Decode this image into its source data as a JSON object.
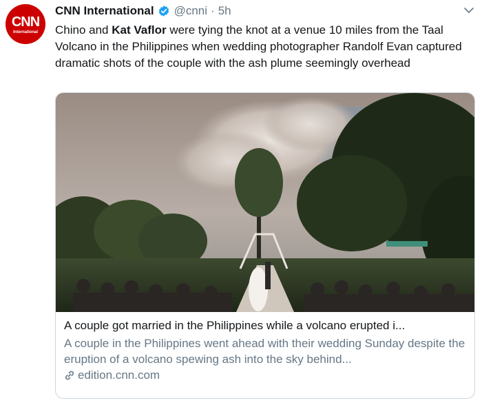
{
  "account": {
    "avatar_logo": "CNN",
    "avatar_sub": "International",
    "name": "CNN International",
    "handle": "@cnni",
    "separator": "·",
    "time": "5h",
    "verified_icon": "verified-badge-icon"
  },
  "tweet": {
    "text_part1": "Chino and ",
    "text_bold": "Kat Vaflor",
    "text_part2": " were tying the knot at a venue 10 miles from the Taal Volcano in the Philippines when wedding photographer Randolf Evan captured dramatic shots of the couple with the ash plume seemingly overhead"
  },
  "card": {
    "title": "A couple got married in the Philippines while a volcano erupted i...",
    "description": "A couple in the Philippines went ahead with their wedding Sunday despite the eruption of a volcano spewing ash into the sky behind...",
    "domain": "edition.cnn.com",
    "link_icon": "link-icon"
  },
  "colors": {
    "avatar_red": "#cc0000",
    "verified_blue": "#1da1f2",
    "secondary_text": "#657786",
    "border": "#ccd6dd"
  }
}
